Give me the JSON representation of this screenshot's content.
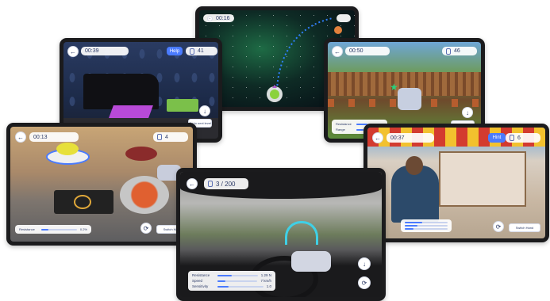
{
  "tablets": {
    "space": {
      "timer": "00:16"
    },
    "sewing": {
      "timer": "00:39",
      "help_label": "Help",
      "score": "41",
      "go_to_next": "Go to next level"
    },
    "garden": {
      "timer": "00:50",
      "score": "46",
      "go_to_next": "Go to next level",
      "slider1_label": "Resistance",
      "slider2_label": "Range"
    },
    "kitchen": {
      "timer": "00:13",
      "score": "4",
      "slider_label": "Resistance",
      "slider_value": "0.2%",
      "switch_hand": "Switch Hand"
    },
    "shooting": {
      "timer": "00:37",
      "help_label": "Hint",
      "score": "6",
      "switch_hand": "Switch Hand"
    },
    "driving": {
      "score": "3 / 200",
      "sliders": [
        {
          "label": "Resistance",
          "value": "1.29 N",
          "level": 0.35
        },
        {
          "label": "Speed",
          "value": "7 km/h",
          "level": 0.2
        },
        {
          "label": "Sensitivity",
          "value": "1.0",
          "level": 0.25
        }
      ]
    }
  },
  "icons": [
    "back-arrow-icon",
    "score-icon",
    "download-icon",
    "settings-icon",
    "rocket-icon",
    "star-icon"
  ],
  "colors": {
    "accent": "#4a7bff",
    "navy": "#2b3a67"
  }
}
